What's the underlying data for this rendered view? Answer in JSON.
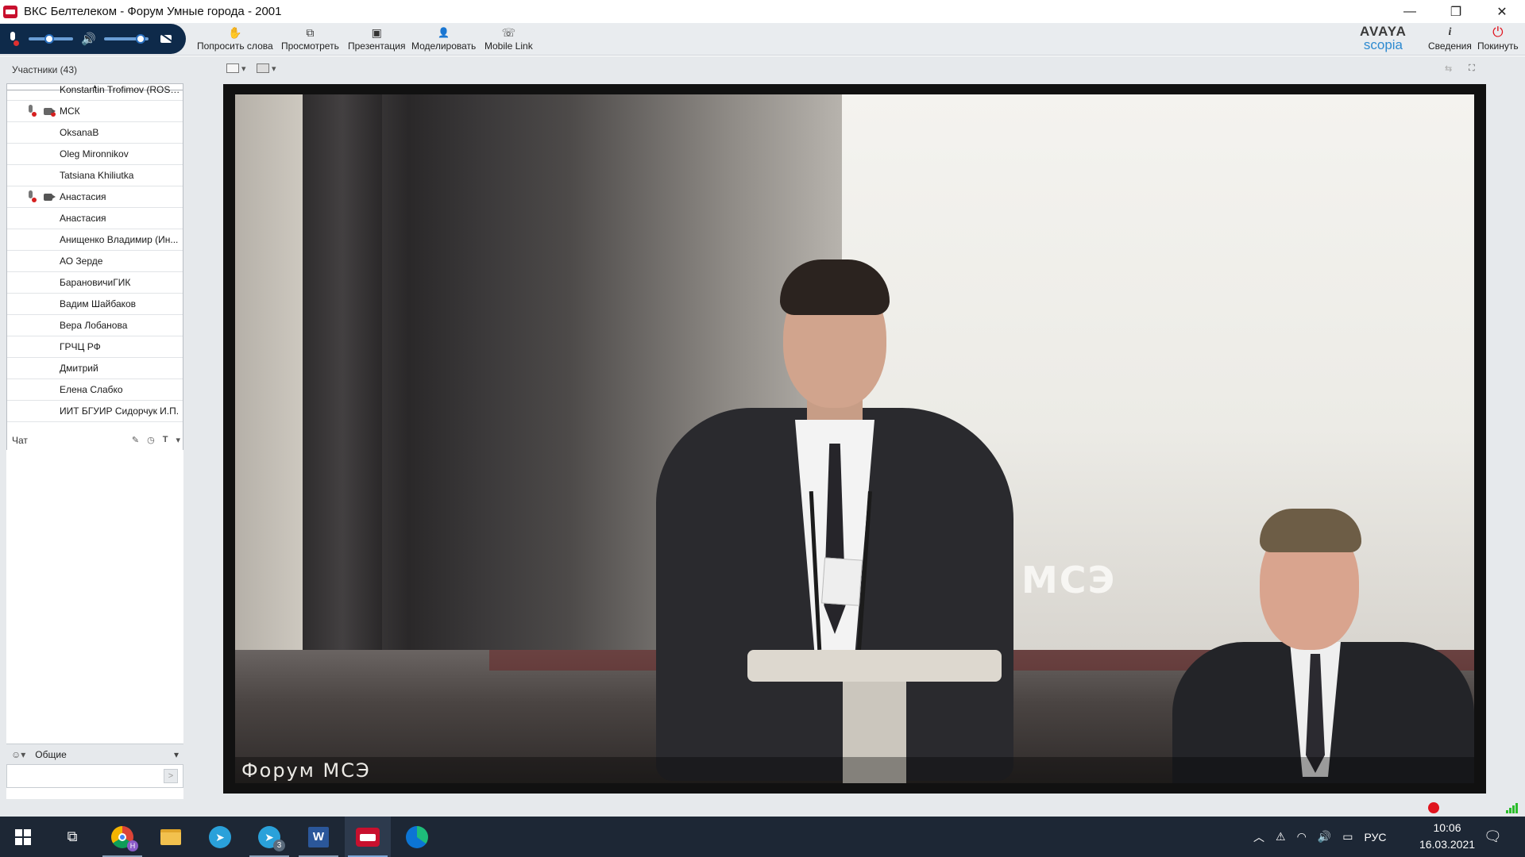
{
  "window": {
    "title": "ВКС Белтелеком - Форум Умные города - 2001",
    "controls": {
      "minimize": "—",
      "restore": "❐",
      "close": "✕"
    }
  },
  "toolbar": {
    "tools": [
      {
        "name": "raise-hand",
        "icon": "hand-icon",
        "glyph": "✋",
        "label": "Попросить слова"
      },
      {
        "name": "view",
        "icon": "view-icon",
        "glyph": "⧉",
        "label": "Просмотреть"
      },
      {
        "name": "presentation",
        "icon": "presentation-icon",
        "glyph": "▣",
        "label": "Презентация"
      },
      {
        "name": "moderate",
        "icon": "person-icon",
        "glyph": "👤",
        "label": "Моделировать"
      },
      {
        "name": "mobile-link",
        "icon": "mobile-link-icon",
        "glyph": "☏",
        "label": "Mobile Link"
      }
    ],
    "brand_line1": "AVAYA",
    "brand_line2": "scopia",
    "info_label": "Сведения",
    "leave_label": "Покинуть",
    "mic_volume": 0.45,
    "speaker_volume": 0.9
  },
  "participants": {
    "header": "Участники (43)",
    "items": [
      {
        "name": "Konstantin Trofimov (ROS, ...",
        "mic_muted": false,
        "camera": "none"
      },
      {
        "name": "МСК",
        "mic_muted": true,
        "camera": "off"
      },
      {
        "name": "OksanaB",
        "mic_muted": false,
        "camera": "none"
      },
      {
        "name": "Oleg Mironnikov",
        "mic_muted": false,
        "camera": "none"
      },
      {
        "name": "Tatsiana Khiliutka",
        "mic_muted": false,
        "camera": "none"
      },
      {
        "name": "Анастасия",
        "mic_muted": true,
        "camera": "on"
      },
      {
        "name": "Анастасия",
        "mic_muted": false,
        "camera": "none"
      },
      {
        "name": "Анищенко Владимир (Ин...",
        "mic_muted": false,
        "camera": "none"
      },
      {
        "name": "АО Зерде",
        "mic_muted": false,
        "camera": "none"
      },
      {
        "name": "БарановичиГИК",
        "mic_muted": false,
        "camera": "none"
      },
      {
        "name": "Вадим Шайбаков",
        "mic_muted": false,
        "camera": "none"
      },
      {
        "name": "Вера Лобанова",
        "mic_muted": false,
        "camera": "none"
      },
      {
        "name": "ГРЧЦ РФ",
        "mic_muted": false,
        "camera": "none"
      },
      {
        "name": "Дмитрий",
        "mic_muted": false,
        "camera": "none"
      },
      {
        "name": "Елена Слабко",
        "mic_muted": false,
        "camera": "none"
      },
      {
        "name": "ИИТ БГУИР Сидорчук И.П.",
        "mic_muted": false,
        "camera": "none"
      }
    ]
  },
  "chat": {
    "header": "Чат",
    "target": "Общие",
    "send_glyph": ">"
  },
  "video": {
    "screen_text": "МСЭ",
    "caption": "Форум МСЭ"
  },
  "taskbar": {
    "apps": [
      "windows-start",
      "task-view",
      "chrome",
      "file-explorer",
      "telegram",
      "telegram-3",
      "word",
      "vks-beltelecom",
      "edge"
    ],
    "telegram_badge": "3",
    "chrome_badge": "H",
    "language": "РУС",
    "time": "10:06",
    "date": "16.03.2021"
  },
  "colors": {
    "accent": "#0e2a4a",
    "brand_blue": "#2d8ad0",
    "leave_red": "#e0141e",
    "taskbar": "#1d2735"
  }
}
